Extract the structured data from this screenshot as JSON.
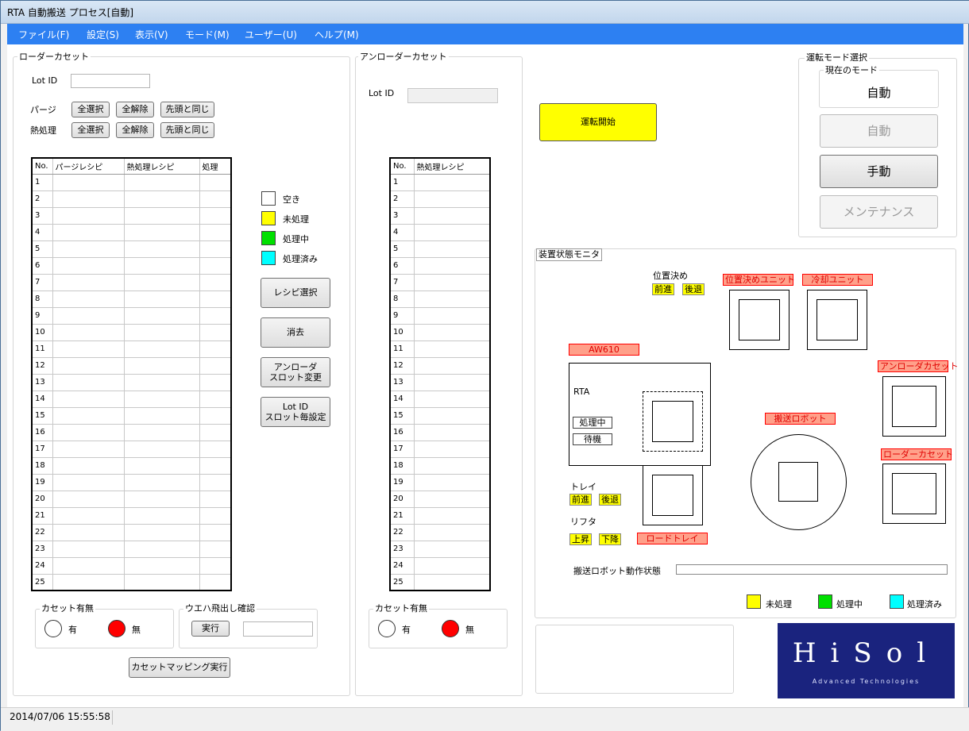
{
  "window": {
    "title": "RTA 自動搬送 プロセス[自動]"
  },
  "menu": [
    "ファイル(F)",
    "設定(S)",
    "表示(V)",
    "モード(M)",
    "ユーザー(U)",
    "ヘルプ(M)"
  ],
  "loader": {
    "group_title": "ローダーカセット",
    "lot_label": "Lot ID",
    "lot_value": "",
    "purge_label": "パージ",
    "heat_label": "熱処理",
    "select_all": "全選択",
    "clear_all": "全解除",
    "same_as_first": "先頭と同じ",
    "columns": [
      "No.",
      "パージレシピ",
      "熱処理レシピ",
      "処理"
    ],
    "rows": [
      "1",
      "2",
      "3",
      "4",
      "5",
      "6",
      "7",
      "8",
      "9",
      "10",
      "11",
      "12",
      "13",
      "14",
      "15",
      "16",
      "17",
      "18",
      "19",
      "20",
      "21",
      "22",
      "23",
      "24",
      "25"
    ]
  },
  "legend": {
    "empty": "空き",
    "unprocessed": "未処理",
    "processing": "処理中",
    "processed": "処理済み"
  },
  "actions": {
    "recipe_select": "レシピ選択",
    "delete": "消去",
    "unloader_slot_line1": "アンローダ",
    "unloader_slot_line2": "スロット変更",
    "lotid_slot_line1": "Lot ID",
    "lotid_slot_line2": "スロット毎設定",
    "cassette_mapping": "カセットマッピング実行"
  },
  "cassette_presence": {
    "title": "カセット有無",
    "yes": "有",
    "no": "無"
  },
  "wafer_check": {
    "title": "ウエハ飛出し確認",
    "run": "実行",
    "value": ""
  },
  "unloader": {
    "group_title": "アンローダーカセット",
    "lot_label": "Lot ID",
    "lot_value": "",
    "columns": [
      "No.",
      "熱処理レシピ"
    ],
    "rows": [
      "1",
      "2",
      "3",
      "4",
      "5",
      "6",
      "7",
      "8",
      "9",
      "10",
      "11",
      "12",
      "13",
      "14",
      "15",
      "16",
      "17",
      "18",
      "19",
      "20",
      "21",
      "22",
      "23",
      "24",
      "25"
    ]
  },
  "start_button": "運転開始",
  "mode": {
    "group_title": "運転モード選択",
    "current_title": "現在のモード",
    "current_value": "自動",
    "auto": "自動",
    "manual": "手動",
    "maintenance": "メンテナンス"
  },
  "monitor": {
    "title": "装置状態モニタ",
    "positioning": "位置決め",
    "forward": "前進",
    "backward": "後退",
    "positioning_unit": "位置決めユニット",
    "cooling_unit": "冷却ユニット",
    "aw610": "AW610",
    "rta": "RTA",
    "rta_processing": "処理中",
    "rta_waiting": "待機",
    "unloader_cassette": "アンローダカセット",
    "transfer_robot": "搬送ロボット",
    "loader_cassette": "ローダーカセット",
    "tray": "トレイ",
    "tray_forward": "前進",
    "tray_backward": "後退",
    "lifter": "リフタ",
    "lift_up": "上昇",
    "lift_down": "下降",
    "load_tray": "ロードトレイ",
    "robot_status_label": "搬送ロボット動作状態",
    "legend": {
      "unprocessed": "未処理",
      "processing": "処理中",
      "processed": "処理済み"
    }
  },
  "logo": {
    "main": "HiSol",
    "sub": "Advanced Technologies"
  },
  "colors": {
    "yellow": "#ffff00",
    "green": "#00e000",
    "cyan": "#00ffff",
    "red": "#ff0000",
    "menu": "#2d80f2",
    "logo_bg": "#1a237e"
  },
  "status_bar": {
    "datetime": "2014/07/06 15:55:58"
  }
}
